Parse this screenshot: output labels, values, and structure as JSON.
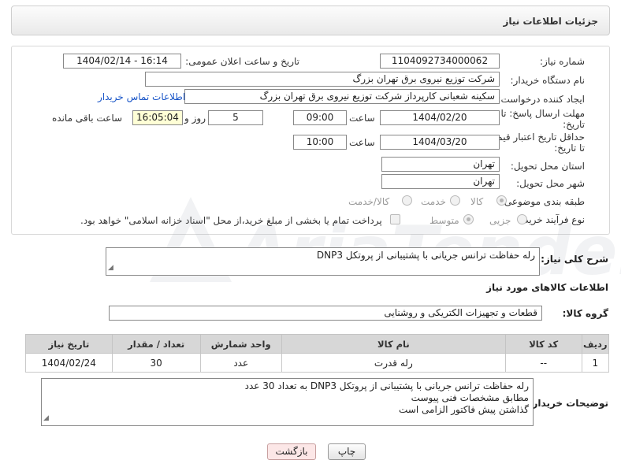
{
  "header": {
    "title": "جزئیات اطلاعات نیاز"
  },
  "form": {
    "need_number_label": "شماره نیاز:",
    "need_number": "1104092734000062",
    "announce_label": "تاریخ و ساعت اعلان عمومی:",
    "announce_value": "1404/02/14 - 16:14",
    "buyer_label": "نام دستگاه خریدار:",
    "buyer_value": "شرکت توزیع نیروی برق تهران بزرگ",
    "creator_label": "ایجاد کننده درخواست:",
    "creator_value": "سکینه شعبانی کارپرداز شرکت توزیع نیروی برق تهران بزرگ",
    "contact_link": "اطلاعات تماس خریدار",
    "deadline_label_1": "مهلت ارسال پاسخ: تا",
    "deadline_label_2": "تاریخ:",
    "deadline_date": "1404/02/20",
    "time_label": "ساعت",
    "deadline_time": "09:00",
    "days_value": "5",
    "days_label": "روز و",
    "remaining_time": "16:05:04",
    "remaining_label": "ساعت باقی مانده",
    "validity_label_1": "حداقل تاریخ اعتبار قیمت:",
    "validity_label_2": "تا تاریخ:",
    "validity_date": "1404/03/20",
    "validity_time": "10:00",
    "province_label": "استان محل تحویل:",
    "province_value": "تهران",
    "city_label": "شهر محل تحویل:",
    "city_value": "تهران",
    "category_label": "طبقه بندی موضوعی:",
    "category_options": [
      "کالا",
      "خدمت",
      "کالا/خدمت"
    ],
    "process_label": "نوع فرآیند خرید :",
    "process_options": [
      "جزیی",
      "متوسط"
    ],
    "payment_note": "پرداخت تمام یا بخشی از مبلغ خرید،از محل \"اسناد خزانه اسلامی\" خواهد بود."
  },
  "description": {
    "label": "شرح کلی نیاز:",
    "value": "رله حفاظت ترانس جریانی با پشتیبانی از پروتکل DNP3"
  },
  "goods": {
    "section_title": "اطلاعات کالاهای مورد نیاز",
    "group_label": "گروه کالا:",
    "group_value": "قطعات و تجهیزات الکتریکی و روشنایی",
    "columns": [
      "ردیف",
      "کد کالا",
      "نام کالا",
      "واحد شمارش",
      "تعداد / مقدار",
      "تاریخ نیاز"
    ],
    "rows": [
      [
        "1",
        "--",
        "رله قدرت",
        "عدد",
        "30",
        "1404/02/24"
      ]
    ]
  },
  "buyer_notes": {
    "label": "توضیحات خریدار:",
    "lines": [
      "رله حفاظت ترانس جریانی با پشتیبانی از پروتکل DNP3 به تعداد 30 عدد",
      "مطابق مشخصات فنی پیوست",
      "گذاشتن پیش فاکتور الزامی است"
    ]
  },
  "buttons": {
    "print": "چاپ",
    "back": "بازگشت"
  },
  "watermark": "AriaTender.net"
}
